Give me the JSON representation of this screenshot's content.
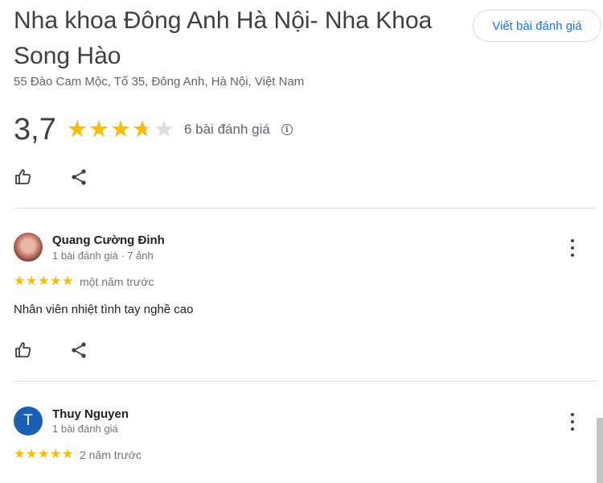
{
  "place": {
    "title": "Nha khoa Đông Anh Hà Nội- Nha Khoa Song Hào",
    "address": "55 Đào Cam Mộc, Tổ 35, Đông Anh, Hà Nội, Việt Nam",
    "rating": "3,7",
    "rating_value": 3.7,
    "review_count": "6 bài đánh giá",
    "write_review_label": "Viết bài đánh giá"
  },
  "colors": {
    "star": "#fbbc04",
    "star_empty": "#dadce0",
    "accent": "#1a73e8",
    "avatar_bg": "#1a5fb4"
  },
  "icons": [
    "thumb-up-icon",
    "share-icon",
    "info-icon",
    "more-vert-icon",
    "star-icon"
  ],
  "reviews": [
    {
      "name": "Quang Cường Đinh",
      "meta": "1 bài đánh giá · 7 ảnh",
      "rating": 5,
      "time": "một năm trước",
      "text": "Nhân viên nhiệt tình tay nghề cao"
    },
    {
      "name": "Thuy Nguyen",
      "avatar_letter": "T",
      "meta": "1 bài đánh giá",
      "rating": 5,
      "time": "2 năm trước"
    }
  ]
}
